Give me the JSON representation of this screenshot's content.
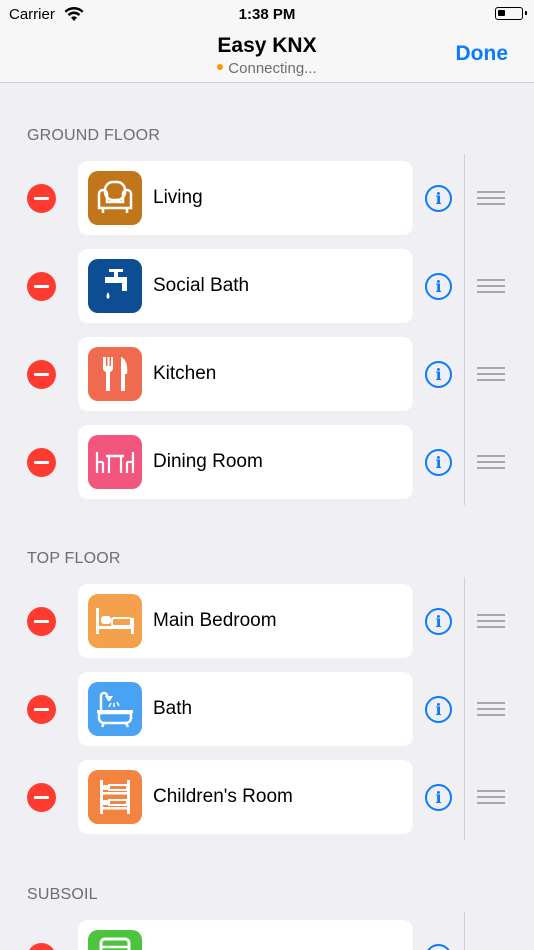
{
  "status_bar": {
    "carrier": "Carrier",
    "time": "1:38 PM"
  },
  "nav": {
    "title": "Easy KNX",
    "status": "Connecting...",
    "status_color": "#ff9500",
    "done_label": "Done",
    "accent": "#0a7aff"
  },
  "sections": [
    {
      "title": "GROUND FLOOR",
      "rooms": [
        {
          "label": "Living",
          "icon": "armchair-icon",
          "color": "#c2761b"
        },
        {
          "label": "Social Bath",
          "icon": "faucet-icon",
          "color": "#0c4d94"
        },
        {
          "label": "Kitchen",
          "icon": "fork-knife-icon",
          "color": "#f06a4f"
        },
        {
          "label": "Dining Room",
          "icon": "dining-table-icon",
          "color": "#f2567f"
        }
      ]
    },
    {
      "title": "TOP FLOOR",
      "rooms": [
        {
          "label": "Main Bedroom",
          "icon": "bed-icon",
          "color": "#f5a04c"
        },
        {
          "label": "Bath",
          "icon": "bathtub-icon",
          "color": "#4aa3f2"
        },
        {
          "label": "Children's Room",
          "icon": "bunk-bed-icon",
          "color": "#f28340"
        }
      ]
    },
    {
      "title": "SUBSOIL",
      "rooms": [
        {
          "label": "",
          "icon": "washer-icon",
          "color": "#4cc43d"
        }
      ]
    }
  ],
  "info_glyph": "i"
}
